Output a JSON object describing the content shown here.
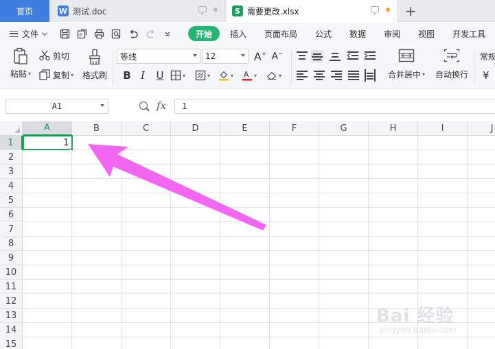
{
  "tabs": {
    "home": "首页",
    "doc": "测试.doc",
    "xlsx": "需要更改.xlsx",
    "new_tab": "+"
  },
  "menu": {
    "file": "文件",
    "items": [
      "开始",
      "插入",
      "页面布局",
      "公式",
      "数据",
      "审阅",
      "视图",
      "开发工具"
    ]
  },
  "ribbon": {
    "paste": "粘贴",
    "cut": "剪切",
    "copy": "复制",
    "format_painter": "格式刷",
    "font_name": "等线",
    "font_size": "12",
    "merge_center": "合并居中",
    "wrap_text": "自动换行",
    "general_truncated": "常规",
    "currency_symbol": "¥"
  },
  "formula_bar": {
    "name_box": "A1",
    "fx": "fx",
    "content": "1"
  },
  "grid": {
    "columns": [
      "A",
      "B",
      "C",
      "D",
      "E",
      "F",
      "G",
      "H",
      "I",
      "J"
    ],
    "rows": [
      "1",
      "2",
      "3",
      "4",
      "5",
      "6",
      "7",
      "8",
      "9",
      "10",
      "11",
      "12",
      "13",
      "14",
      "15"
    ],
    "active_cell": "A1",
    "active_value": "1"
  },
  "annotation": {
    "arrow_color": "#f266f2"
  },
  "watermark": {
    "main": "Bai 经验",
    "sub": "jingyan.baidu.com"
  },
  "colors": {
    "home_tab": "#3f7fe0",
    "accent_green": "#22b573",
    "selection_green": "#1f9d55"
  }
}
